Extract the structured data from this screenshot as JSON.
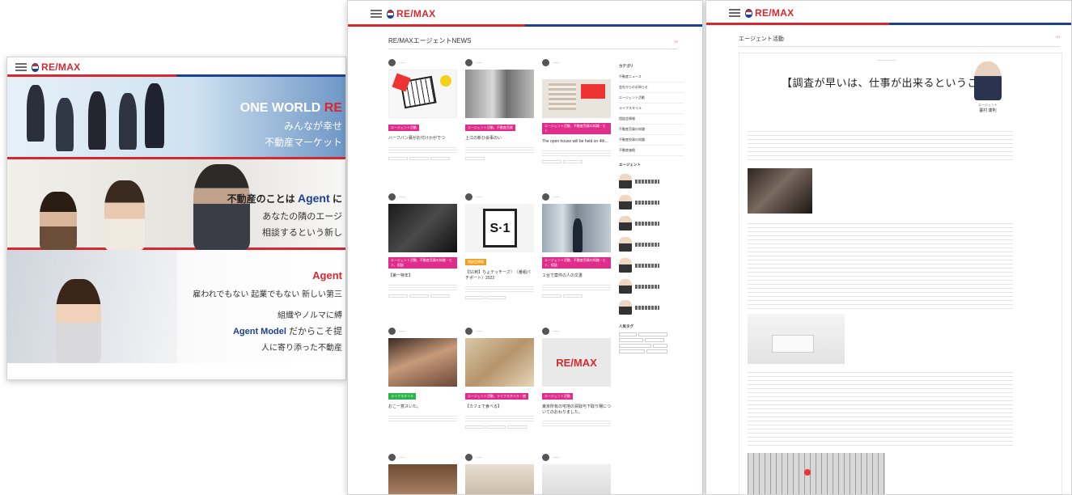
{
  "brand": {
    "logo_text": "RE/MAX"
  },
  "colors": {
    "red": "#d7282f",
    "blue": "#1f3f8f",
    "pink": "#e02d8c"
  },
  "top_page": {
    "hero1": {
      "line1_a": "ONE WORLD ",
      "line1_b": "RE",
      "line2": "みんなが幸せ",
      "line3": "不動産マーケット"
    },
    "hero2": {
      "line1_a": "不動産のことは ",
      "line1_b": "Agent",
      "line1_c": " に",
      "line2": "あなたの隣のエージ",
      "line3": "相談するという新し"
    },
    "hero3": {
      "line1": "Agent",
      "line2": "雇われでもない 起業でもない 新しい第三",
      "line3": "組織やノルマに縛",
      "line4_a": "Agent Model",
      "line4_b": " だからこそ提",
      "line5": "人に寄り添った不動産"
    }
  },
  "news_page": {
    "section_title": "RE/MAXエージェントNEWS",
    "cards": [
      {
        "tag": "エージェント活動",
        "title": "ハーフパン募がお付けかがでつ"
      },
      {
        "tag": "エージェント活動、不動産売買",
        "title": "上江の新ひ会事のい"
      },
      {
        "tag": "エージェント活動、不動産売買の知識・ヒト",
        "title": "The open house will be held on 4th..."
      },
      {
        "tag": "エージェント活動、不動産売買の知識・ヒト、相談",
        "title": "【第一特年】"
      },
      {
        "tag": "相談会情報",
        "title": "【S1到】ちょテッチーズ！（番組パチポート）2022"
      },
      {
        "tag": "エージェント活動、不動産売買の知識・ヒト、相談",
        "title": "２台で案件の人の文書"
      },
      {
        "tag": "ライフスタイル",
        "title": "おこ一意スいた。"
      },
      {
        "tag": "エージェント活動、ライフスタイル・旅",
        "title": "【カフェで食べる】"
      },
      {
        "tag": "エージェント活動",
        "title": "東京所有の宅地の買取与下取り場についてのおわりました。"
      }
    ],
    "card9_logo": "RE/MAX",
    "sidebar": {
      "category_title": "カテゴリ",
      "categories": [
        "不動産ニュース",
        "会社からのお知らせ",
        "エージェント活動",
        "ライフスタイル",
        "相談会情報",
        "不動産売買の知識",
        "不動産投資の知識",
        "不動産価格"
      ],
      "agent_title": "エージェント",
      "tags_title": "人気タグ"
    }
  },
  "article_page": {
    "breadcrumb": "エージェント活動",
    "article_title": "【調査が早いは、仕事が出来るということ】",
    "author_role": "エージェント",
    "author_name": "臺村 康則"
  }
}
